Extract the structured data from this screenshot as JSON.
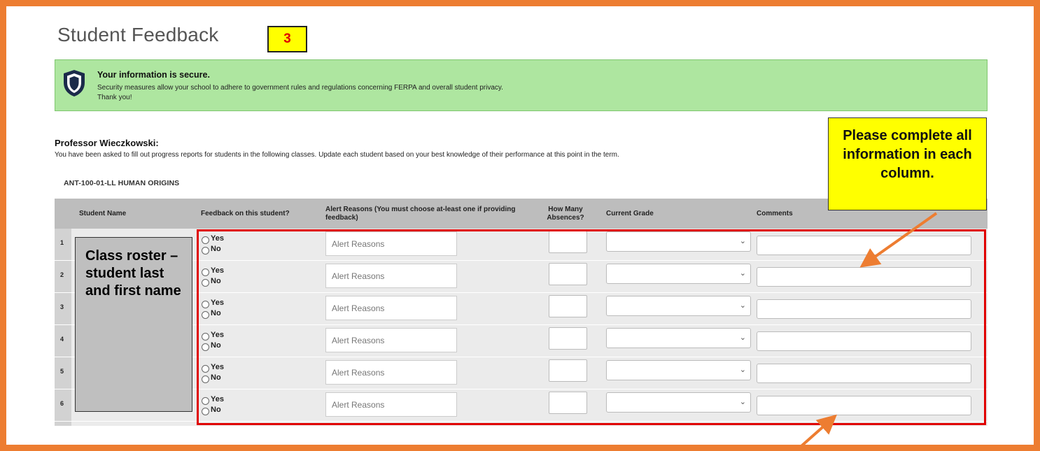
{
  "page": {
    "title": "Student Feedback",
    "step_number": "3"
  },
  "security_notice": {
    "title": "Your information is secure.",
    "line1": "Security measures allow your school to adhere to government rules and regulations concerning FERPA and overall student privacy.",
    "line2": "Thank you!",
    "icon": "shield-icon"
  },
  "professor": {
    "greeting": "Professor Wieczkowski:",
    "instructions": "You have been asked to fill out progress reports for students in the following classes. Update each student based on your best knowledge of their performance at this point in the term."
  },
  "course": {
    "label": "ANT-100-01-LL HUMAN ORIGINS"
  },
  "table": {
    "headers": {
      "student_name": "Student Name",
      "feedback": "Feedback on this student?",
      "alert_reasons": "Alert Reasons (You must choose at-least one if providing feedback)",
      "absences": "How Many Absences?",
      "current_grade": "Current Grade",
      "comments": "Comments"
    },
    "rows": [
      {
        "num": "1",
        "yes": "Yes",
        "no": "No",
        "alert_placeholder": "Alert Reasons"
      },
      {
        "num": "2",
        "yes": "Yes",
        "no": "No",
        "alert_placeholder": "Alert Reasons"
      },
      {
        "num": "3",
        "yes": "Yes",
        "no": "No",
        "alert_placeholder": "Alert Reasons"
      },
      {
        "num": "4",
        "yes": "Yes",
        "no": "No",
        "alert_placeholder": "Alert Reasons"
      },
      {
        "num": "5",
        "yes": "Yes",
        "no": "No",
        "alert_placeholder": "Alert Reasons"
      },
      {
        "num": "6",
        "yes": "Yes",
        "no": "No",
        "alert_placeholder": "Alert Reasons"
      }
    ]
  },
  "annotations": {
    "roster_callout": "Class roster – student last and first name",
    "complete_callout": "Please complete all information in each column."
  },
  "colors": {
    "frame": "#ED7D31",
    "notice_bg": "#AEE6A0",
    "highlight_box": "#E00000",
    "callout_yellow": "#FFFF00"
  }
}
